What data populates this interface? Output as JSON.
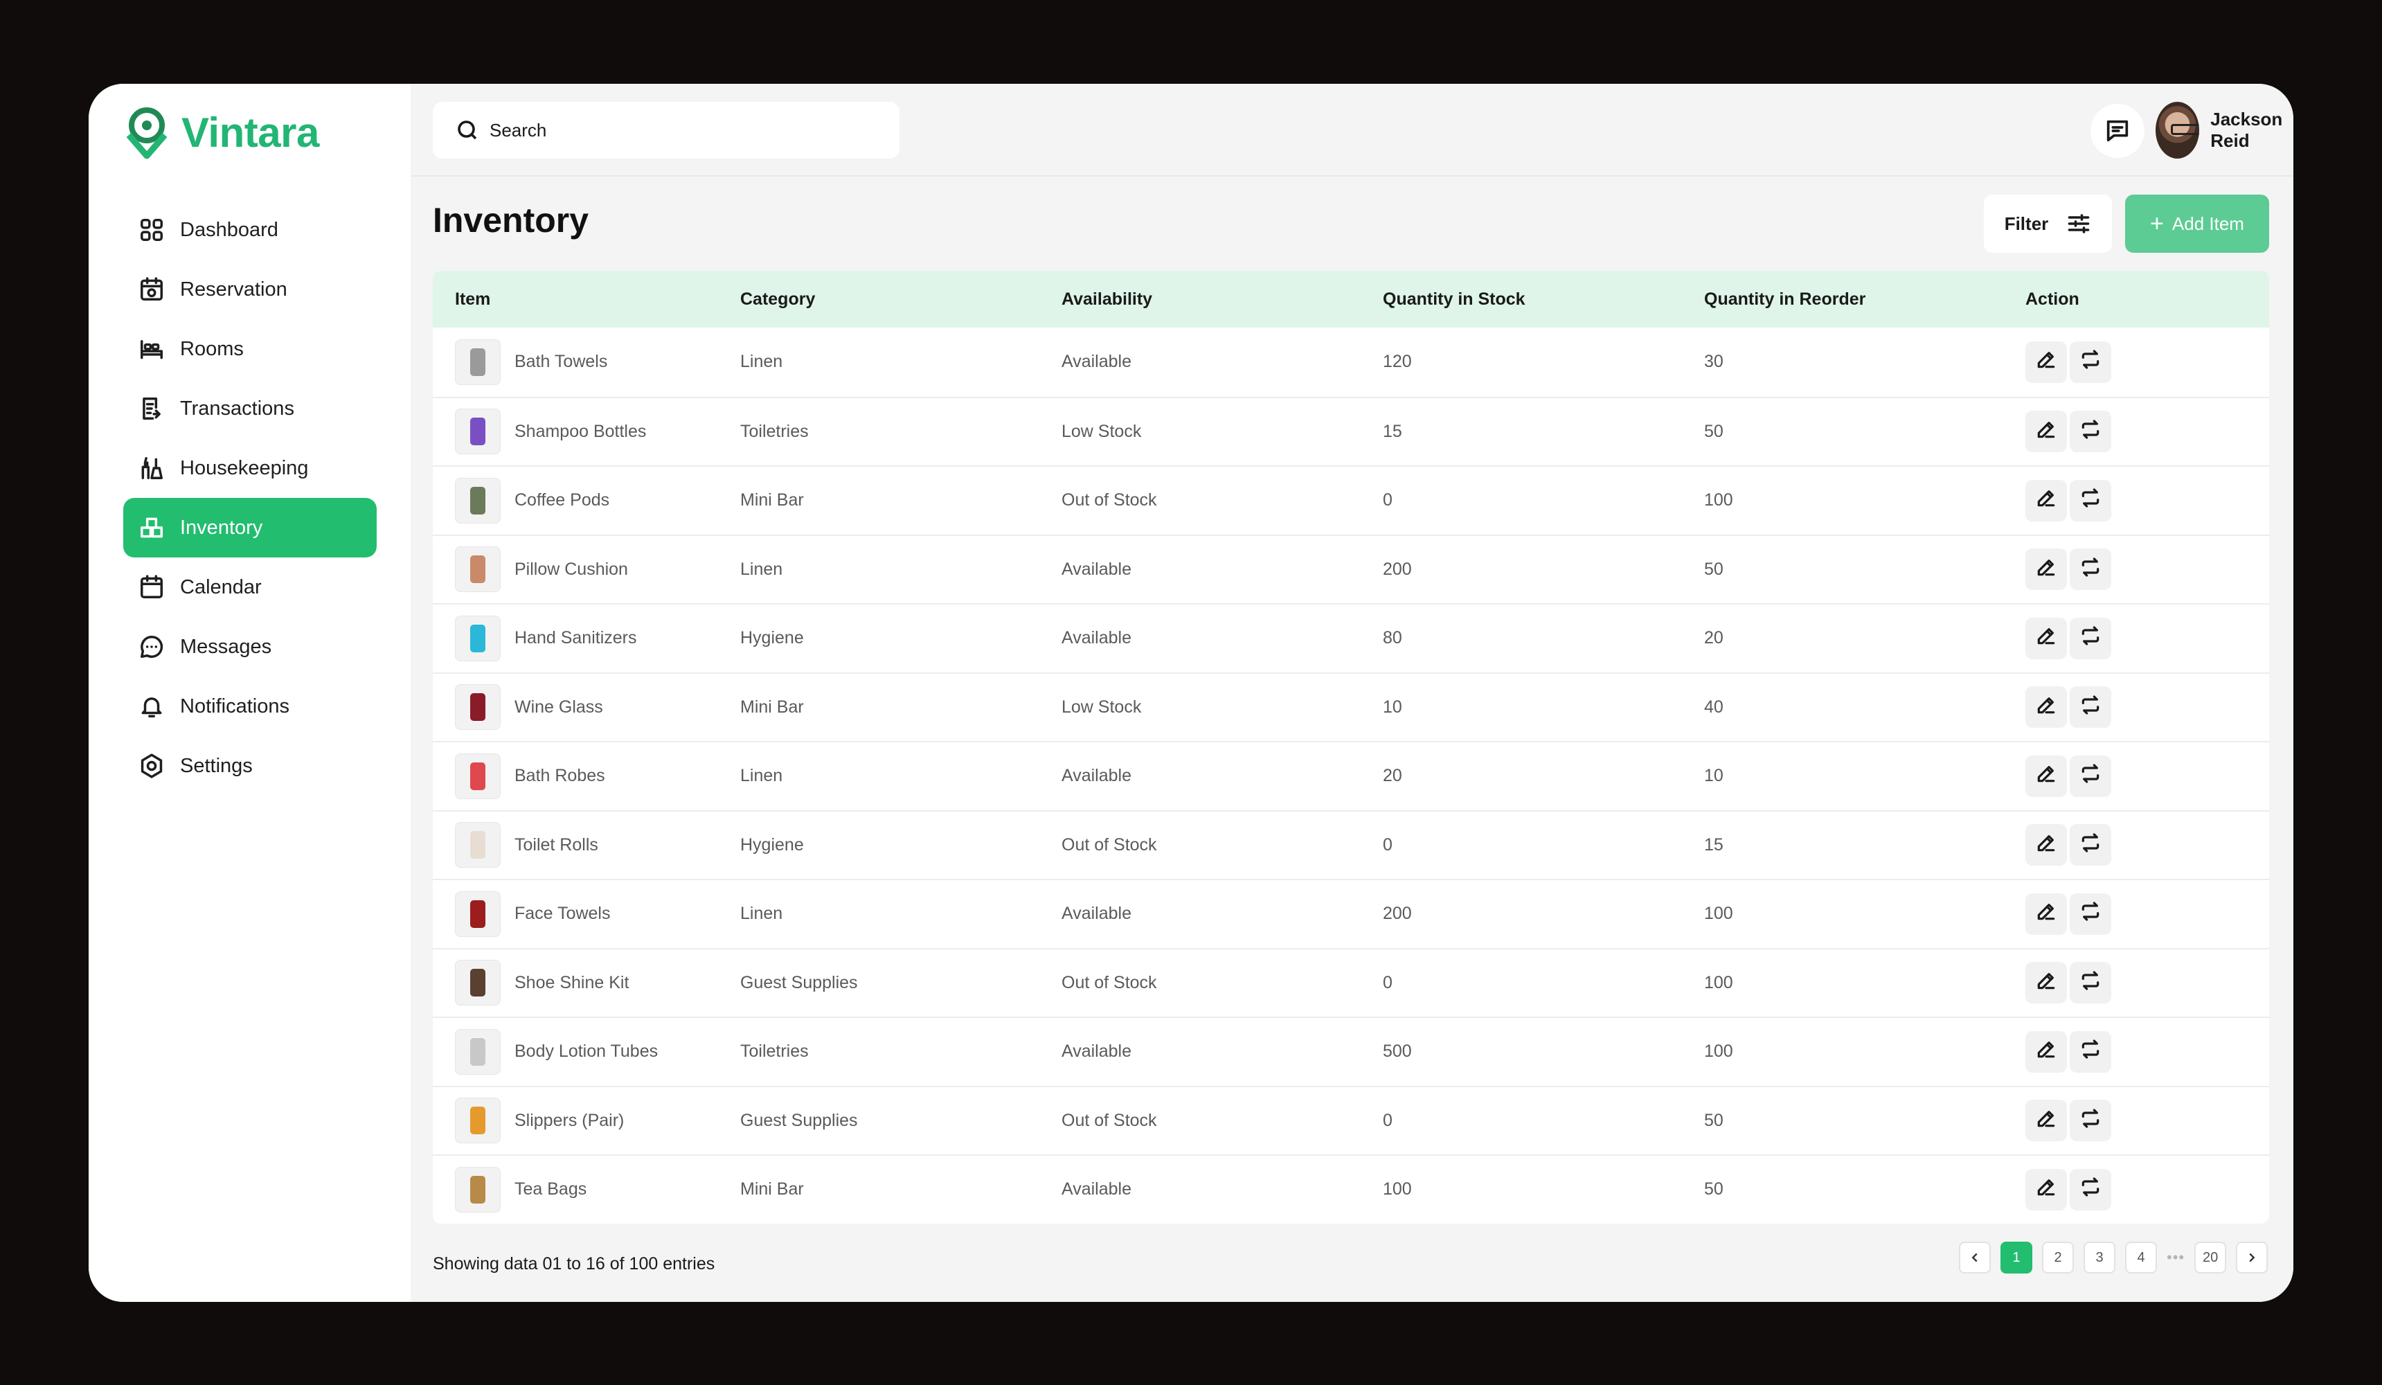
{
  "app": {
    "name": "Vintara",
    "brand_color": "#22b573",
    "accent_color": "#22bd6f"
  },
  "sidebar": {
    "items": [
      {
        "label": "Dashboard",
        "icon": "dashboard-grid-icon",
        "active": false
      },
      {
        "label": "Reservation",
        "icon": "calendar-camera-icon",
        "active": false
      },
      {
        "label": "Rooms",
        "icon": "bed-icon",
        "active": false
      },
      {
        "label": "Transactions",
        "icon": "receipt-icon",
        "active": false
      },
      {
        "label": "Housekeeping",
        "icon": "cleaning-icon",
        "active": false
      },
      {
        "label": "Inventory",
        "icon": "boxes-icon",
        "active": true
      },
      {
        "label": "Calendar",
        "icon": "calendar-icon",
        "active": false
      },
      {
        "label": "Messages",
        "icon": "chat-bubble-icon",
        "active": false
      },
      {
        "label": "Notifications",
        "icon": "bell-icon",
        "active": false
      },
      {
        "label": "Settings",
        "icon": "gear-icon",
        "active": false
      }
    ]
  },
  "header": {
    "search_placeholder": "Search",
    "user_name": "Jackson Reid"
  },
  "page": {
    "title": "Inventory",
    "filter_label": "Filter",
    "add_label": "Add Item"
  },
  "table": {
    "columns": [
      "Item",
      "Category",
      "Availability",
      "Quantity in Stock",
      "Quantity in Reorder",
      "Action"
    ],
    "rows": [
      {
        "item": "Bath Towels",
        "category": "Linen",
        "availability": "Available",
        "stock": "120",
        "reorder": "30",
        "thumb_color": "#9a9a9a"
      },
      {
        "item": "Shampoo Bottles",
        "category": "Toiletries",
        "availability": "Low Stock",
        "stock": "15",
        "reorder": "50",
        "thumb_color": "#7a4fc4"
      },
      {
        "item": "Coffee Pods",
        "category": "Mini Bar",
        "availability": "Out of Stock",
        "stock": "0",
        "reorder": "100",
        "thumb_color": "#6b7a5a"
      },
      {
        "item": "Pillow Cushion",
        "category": "Linen",
        "availability": "Available",
        "stock": "200",
        "reorder": "50",
        "thumb_color": "#c98a6a"
      },
      {
        "item": "Hand Sanitizers",
        "category": "Hygiene",
        "availability": "Available",
        "stock": "80",
        "reorder": "20",
        "thumb_color": "#2ab7d8"
      },
      {
        "item": "Wine Glass",
        "category": "Mini Bar",
        "availability": "Low Stock",
        "stock": "10",
        "reorder": "40",
        "thumb_color": "#8a1c2a"
      },
      {
        "item": "Bath Robes",
        "category": "Linen",
        "availability": "Available",
        "stock": "20",
        "reorder": "10",
        "thumb_color": "#e0484f"
      },
      {
        "item": "Toilet Rolls",
        "category": "Hygiene",
        "availability": "Out of Stock",
        "stock": "0",
        "reorder": "15",
        "thumb_color": "#e8ddd2"
      },
      {
        "item": "Face Towels",
        "category": "Linen",
        "availability": "Available",
        "stock": "200",
        "reorder": "100",
        "thumb_color": "#9b1d1d"
      },
      {
        "item": "Shoe Shine Kit",
        "category": "Guest Supplies",
        "availability": "Out of Stock",
        "stock": "0",
        "reorder": "100",
        "thumb_color": "#5a4030"
      },
      {
        "item": "Body Lotion Tubes",
        "category": "Toiletries",
        "availability": "Available",
        "stock": "500",
        "reorder": "100",
        "thumb_color": "#c8c8c8"
      },
      {
        "item": "Slippers (Pair)",
        "category": "Guest Supplies",
        "availability": "Out of Stock",
        "stock": "0",
        "reorder": "50",
        "thumb_color": "#e59a2e"
      },
      {
        "item": "Tea Bags",
        "category": "Mini Bar",
        "availability": "Available",
        "stock": "100",
        "reorder": "50",
        "thumb_color": "#b78a4a"
      }
    ]
  },
  "footer": {
    "showing": "Showing data 01 to 16 of  100 entries",
    "pages": [
      "1",
      "2",
      "3",
      "4",
      "20"
    ],
    "current_page": "1"
  }
}
